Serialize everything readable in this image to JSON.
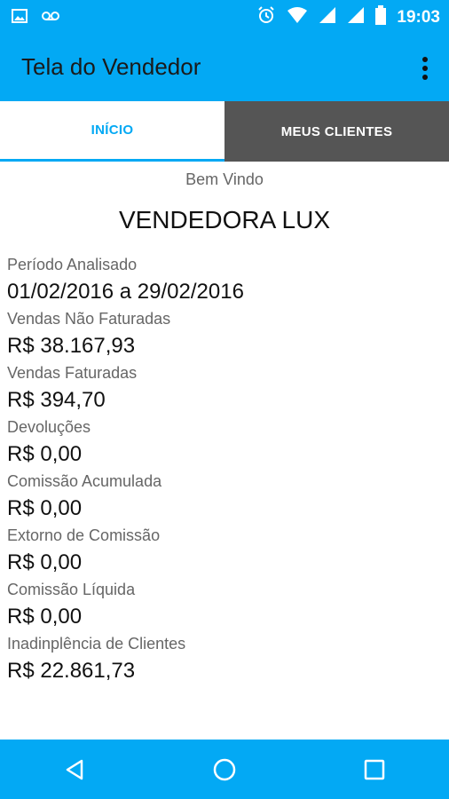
{
  "status_bar": {
    "time": "19:03",
    "left_icons": [
      "image-icon",
      "voicemail-icon"
    ],
    "right_icons": [
      "alarm-icon",
      "wifi-icon",
      "signal-icon",
      "signal-icon",
      "battery-icon"
    ]
  },
  "app_bar": {
    "title": "Tela do Vendedor"
  },
  "tabs": [
    {
      "label": "INÍCIO",
      "active": true
    },
    {
      "label": "MEUS CLIENTES",
      "active": false
    }
  ],
  "welcome": {
    "greeting": "Bem Vindo",
    "vendor_name": "VENDEDORA LUX"
  },
  "fields": [
    {
      "label": "Período Analisado",
      "value": "01/02/2016 a 29/02/2016"
    },
    {
      "label": "Vendas Não Faturadas",
      "value": "R$ 38.167,93"
    },
    {
      "label": "Vendas Faturadas",
      "value": "R$ 394,70"
    },
    {
      "label": "Devoluções",
      "value": "R$ 0,00"
    },
    {
      "label": "Comissão Acumulada",
      "value": "R$ 0,00"
    },
    {
      "label": "Extorno de Comissão",
      "value": "R$ 0,00"
    },
    {
      "label": "Comissão Líquida",
      "value": "R$ 0,00"
    },
    {
      "label": "Inadinplência de Clientes",
      "value": "R$ 22.861,73"
    }
  ],
  "colors": {
    "accent": "#03a9f4",
    "inactive_tab": "#555555"
  }
}
